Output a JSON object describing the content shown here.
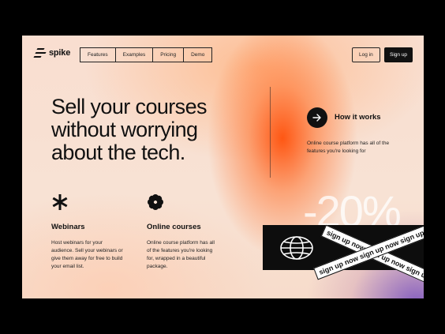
{
  "brand": {
    "name": "spike"
  },
  "nav": {
    "items": [
      "Features",
      "Examples",
      "Pricing",
      "Demo"
    ]
  },
  "auth": {
    "login": "Log in",
    "signup": "Sign up"
  },
  "hero": {
    "headline": "Sell your courses without worrying about the tech."
  },
  "how_it_works": {
    "title": "How it works",
    "description": "Online course platform has all of the features you're looking for"
  },
  "features": [
    {
      "title": "Webinars",
      "description": "Host webinars for your audience. Sell your webinars or give them away for free to build your email list."
    },
    {
      "title": "Online courses",
      "description": "Online course platform has all of the features you're looking for, wrapped in a beautiful package."
    }
  ],
  "promo": {
    "discount": "-20%",
    "tape_text": "sign up now sign up now sign up now sign up now"
  },
  "colors": {
    "accent": "#ff5a14",
    "dark": "#111111",
    "background": "#f8e0d2"
  },
  "icons": {
    "logo": "spike-logo-icon",
    "arrow": "arrow-right-icon",
    "feature_1": "asterisk-icon",
    "feature_2": "flower-icon",
    "promo": "globe-icon"
  }
}
